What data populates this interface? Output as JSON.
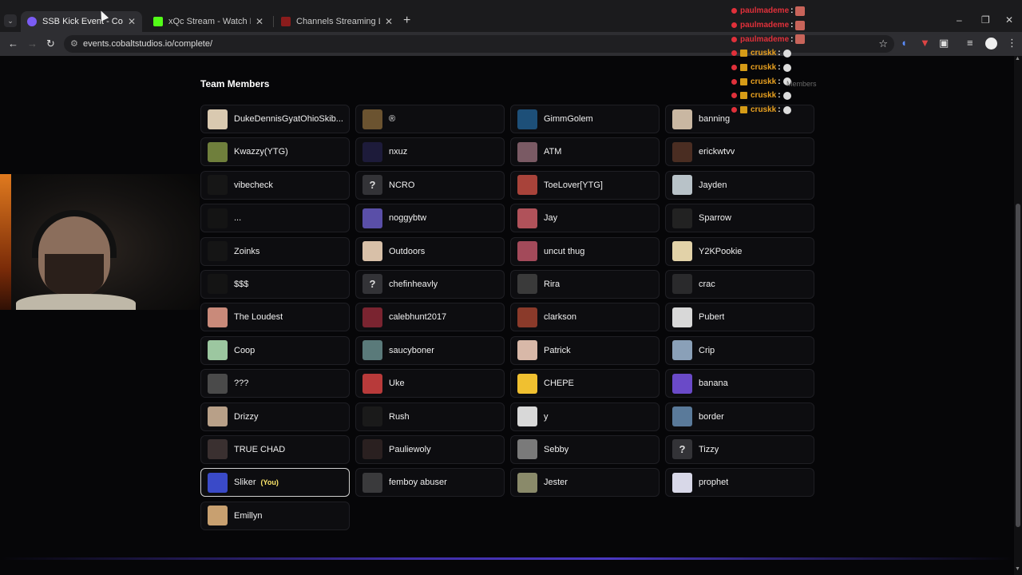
{
  "browser": {
    "tabs": [
      {
        "title": "SSB Kick Event - Cobalt Studios",
        "favicon_color": "#7b5cf5",
        "active": true
      },
      {
        "title": "xQc Stream - Watch Live on Kick",
        "favicon_color": "#53fc18",
        "active": false
      },
      {
        "title": "Channels Streaming Live Now",
        "favicon_color": "#8a1c1c",
        "active": false
      }
    ],
    "new_tab_glyph": "+",
    "url": "events.cobaltstudios.io/complete/",
    "window_controls": {
      "minimize": "–",
      "maximize": "❐",
      "close": "✕"
    }
  },
  "page": {
    "section_title": "Team Members",
    "you_badge": "(You)",
    "members": [
      {
        "name": "DukeDennisGyatOhioSkib...",
        "avatar_color": "#d9c9b0"
      },
      {
        "name": "®",
        "avatar_color": "#6b5330"
      },
      {
        "name": "GimmGolem",
        "avatar_color": "#1d4f78"
      },
      {
        "name": "banning",
        "avatar_color": "#c9b7a2"
      },
      {
        "name": "Kwazzy(YTG)",
        "avatar_color": "#6f7f3c"
      },
      {
        "name": "nxuz",
        "avatar_color": "#1d1b3a"
      },
      {
        "name": "ATM",
        "avatar_color": "#7a5a64"
      },
      {
        "name": "erickwtvv",
        "avatar_color": "#4a2d22"
      },
      {
        "name": "vibecheck",
        "avatar_color": "#161616"
      },
      {
        "name": "NCRO",
        "avatar_color": "#333337",
        "glyph": "?"
      },
      {
        "name": "ToeLover[YTG]",
        "avatar_color": "#a8433a"
      },
      {
        "name": "Jayden",
        "avatar_color": "#b8c2c8"
      },
      {
        "name": "...",
        "avatar_color": "#141414"
      },
      {
        "name": "noggybtw",
        "avatar_color": "#5a4fa8"
      },
      {
        "name": "Jay",
        "avatar_color": "#b0525a"
      },
      {
        "name": "Sparrow",
        "avatar_color": "#222222"
      },
      {
        "name": "Zoinks",
        "avatar_color": "#151515"
      },
      {
        "name": "Outdoors",
        "avatar_color": "#d8c0a8"
      },
      {
        "name": "uncut thug",
        "avatar_color": "#a34a5a"
      },
      {
        "name": "Y2KPookie",
        "avatar_color": "#e2d2a8"
      },
      {
        "name": "$$$",
        "avatar_color": "#141414"
      },
      {
        "name": "chefinheavly",
        "avatar_color": "#333337",
        "glyph": "?"
      },
      {
        "name": "Rira",
        "avatar_color": "#3a3a3a"
      },
      {
        "name": "crac",
        "avatar_color": "#2a2a2c"
      },
      {
        "name": "The Loudest",
        "avatar_color": "#c98a7a"
      },
      {
        "name": "calebhunt2017",
        "avatar_color": "#7a2430"
      },
      {
        "name": "clarkson",
        "avatar_color": "#8a3a2a"
      },
      {
        "name": "Pubert",
        "avatar_color": "#d8d8d8"
      },
      {
        "name": "Coop",
        "avatar_color": "#9cc7a0"
      },
      {
        "name": "saucyboner",
        "avatar_color": "#5a7a7a"
      },
      {
        "name": "Patrick",
        "avatar_color": "#d8b8a8"
      },
      {
        "name": "Crip",
        "avatar_color": "#8aa0b8"
      },
      {
        "name": "???",
        "avatar_color": "#4a4a4a"
      },
      {
        "name": "Uke",
        "avatar_color": "#b83a3a"
      },
      {
        "name": "CHEPE",
        "avatar_color": "#f0c030"
      },
      {
        "name": "banana",
        "avatar_color": "#6a4ac8"
      },
      {
        "name": "Drizzy",
        "avatar_color": "#b8a088"
      },
      {
        "name": "Rush",
        "avatar_color": "#1a1a1a"
      },
      {
        "name": "y",
        "avatar_color": "#d8d8d8"
      },
      {
        "name": "border",
        "avatar_color": "#5a7a9a"
      },
      {
        "name": "TRUE CHAD",
        "avatar_color": "#3a3030"
      },
      {
        "name": "Pauliewoly",
        "avatar_color": "#2a2020"
      },
      {
        "name": "Sebby",
        "avatar_color": "#7a7a7a"
      },
      {
        "name": "Tizzy",
        "avatar_color": "#333337",
        "glyph": "?"
      },
      {
        "name": "Sliker",
        "avatar_color": "#3a4ac8",
        "you": true
      },
      {
        "name": "femboy abuser",
        "avatar_color": "#3a3a3c"
      },
      {
        "name": "Jester",
        "avatar_color": "#8a8a6a"
      },
      {
        "name": "prophet",
        "avatar_color": "#d8d8e8"
      },
      {
        "name": "Emillyn",
        "avatar_color": "#c8a070"
      }
    ]
  },
  "chat_overlay": {
    "lines": [
      {
        "user": "paulmademe",
        "color": "#e0303a",
        "pre": "#e0303a",
        "emote": "face"
      },
      {
        "user": "paulmademe",
        "color": "#e0303a",
        "pre": "#e0303a",
        "emote": "face"
      },
      {
        "user": "paulmademe",
        "color": "#e0303a",
        "pre": "#e0303a",
        "emote": "face"
      },
      {
        "user": "cruskk",
        "color": "#e8a020",
        "pre": "#e0303a",
        "emote": "bubble"
      },
      {
        "user": "cruskk",
        "color": "#e8a020",
        "pre": "#e0303a",
        "emote": "bubble"
      },
      {
        "user": "cruskk",
        "color": "#e8a020",
        "pre": "#e0303a",
        "emote": "bubble"
      },
      {
        "user": "cruskk",
        "color": "#e8a020",
        "pre": "#e0303a",
        "emote": "bubble"
      },
      {
        "user": "cruskk",
        "color": "#e8a020",
        "pre": "#e0303a",
        "emote": "bubble"
      }
    ],
    "colon": ":",
    "faded_text": "Members"
  }
}
